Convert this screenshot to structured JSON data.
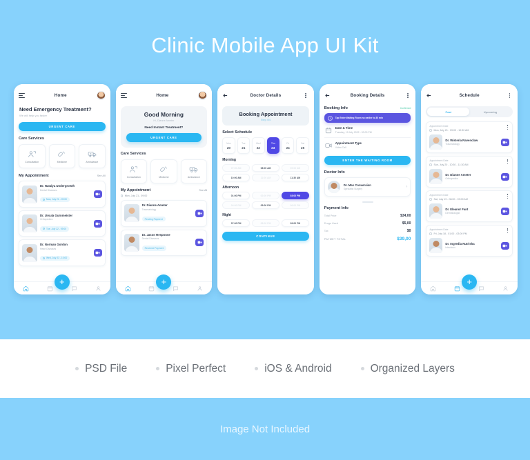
{
  "hero": {
    "title": "Clinic Mobile App UI Kit",
    "bg_color": "#87d2fc"
  },
  "theme": {
    "accent": "#2ab7f2",
    "purple": "#5048e5",
    "text": "#2b3445",
    "muted": "#a8b2bd",
    "green": "#49c9a7"
  },
  "screens": [
    {
      "id": "home-emergency",
      "header": {
        "title": "Home",
        "left_icon": "hamburger-menu-icon",
        "right_icon": "avatar"
      },
      "emergency": {
        "title": "Need Emergency Treatment?",
        "subtitle": "We will help you faster",
        "button": "URGENT CARE"
      },
      "care_services": {
        "title": "Care Services",
        "items": [
          {
            "label": "Consultation",
            "icon": "consultation-icon"
          },
          {
            "label": "Medicine",
            "icon": "medicine-icon"
          },
          {
            "label": "Ambulance",
            "icon": "ambulance-icon"
          }
        ]
      },
      "appointments": {
        "title": "My Appointment",
        "see_all": "See All",
        "items": [
          {
            "name": "Dr. Natalya Undergrowth",
            "specialty": "Dental Diseases",
            "chip": "Mon, July 21 - 09:00"
          },
          {
            "name": "Dr. Ursula Gurnmeister",
            "specialty": "Orthopedics",
            "chip": "Tue, July 22 - 09:00"
          },
          {
            "name": "Dr. Norman Gordon",
            "specialty": "Heart Diseases",
            "chip": "Wed, July 23 - 10:00"
          }
        ]
      },
      "nav": [
        "home-icon",
        "calendar-icon",
        "chat-icon",
        "profile-icon"
      ],
      "fab": "+"
    },
    {
      "id": "home-greeting",
      "header": {
        "title": "Home",
        "left_icon": "hamburger-menu-icon",
        "right_icon": "avatar"
      },
      "greeting": {
        "title": "Good Morning",
        "subtitle": "Hi, Dianne Ameter",
        "question": "Need Instant Treatment?",
        "button": "URGENT CARE"
      },
      "care_services": {
        "title": "Care Services",
        "items": [
          {
            "label": "Consultation",
            "icon": "consultation-icon"
          },
          {
            "label": "Medicine",
            "icon": "medicine-icon"
          },
          {
            "label": "Ambulance",
            "icon": "ambulance-icon"
          }
        ]
      },
      "appointments": {
        "title": "My Appointment",
        "see_all": "See All",
        "date_line": "Mon, July 21 - 09:00",
        "items": [
          {
            "name": "Dr. Dianne Ameter",
            "specialty": "Traumatology",
            "chip": "Pending Payment"
          },
          {
            "name": "Dr. Jason Response",
            "specialty": "Dental Diseases",
            "chip": "Received Payment"
          }
        ]
      },
      "nav": [
        "home-icon",
        "calendar-icon",
        "chat-icon",
        "profile-icon"
      ],
      "fab": "+"
    },
    {
      "id": "doctor-details",
      "header": {
        "title": "Doctor Details",
        "left_icon": "back-arrow-icon",
        "right_icon": "kebab-menu-icon"
      },
      "banner": {
        "title": "Booking Appointment",
        "subtitle": "Step 4/4"
      },
      "schedule": {
        "title": "Select Schedule",
        "days": [
          {
            "weekday": "Mon",
            "date": "20",
            "selected": false
          },
          {
            "weekday": "Tue",
            "date": "21",
            "selected": false
          },
          {
            "weekday": "Wed",
            "date": "22",
            "selected": false
          },
          {
            "weekday": "Thu",
            "date": "23",
            "selected": true
          },
          {
            "weekday": "Fri",
            "date": "24",
            "selected": false
          },
          {
            "weekday": "Sat",
            "date": "25",
            "selected": false
          }
        ]
      },
      "slot_groups": [
        {
          "label": "Morning",
          "rows": [
            [
              {
                "time": "07:00 AM",
                "state": "off"
              },
              {
                "time": "08:00 AM",
                "state": "available"
              },
              {
                "time": "09:00 AM",
                "state": "off"
              }
            ],
            [
              {
                "time": "10:00 AM",
                "state": "available"
              },
              {
                "time": "11:00 AM",
                "state": "off"
              },
              {
                "time": "11:30 AM",
                "state": "available"
              }
            ]
          ]
        },
        {
          "label": "Afternoon",
          "rows": [
            [
              {
                "time": "01:00 PM",
                "state": "available"
              },
              {
                "time": "02:00 PM",
                "state": "off"
              },
              {
                "time": "03:00 PM",
                "state": "selected"
              }
            ],
            [
              {
                "time": "04:00 PM",
                "state": "off"
              },
              {
                "time": "05:00 PM",
                "state": "available"
              },
              {
                "time": "06:00 PM",
                "state": "off"
              }
            ]
          ]
        },
        {
          "label": "Night",
          "rows": [
            [
              {
                "time": "07:00 PM",
                "state": "available"
              },
              {
                "time": "08:00 PM",
                "state": "off"
              },
              {
                "time": "09:00 PM",
                "state": "available"
              }
            ]
          ]
        }
      ],
      "continue_button": "CONTINUE"
    },
    {
      "id": "booking-details",
      "header": {
        "title": "Booking Details",
        "left_icon": "back-arrow-icon",
        "right_icon": "kebab-menu-icon"
      },
      "booking_info": {
        "title": "Booking Info",
        "status": "Confirmed"
      },
      "notice": "Tap Enter Waiting Room no earlier to 30 min",
      "details": [
        {
          "icon": "calendar-icon",
          "label": "Date & Time",
          "value": "Tuesday, 19 July 2022 - 03:00 PM"
        },
        {
          "icon": "video-camera-icon",
          "label": "Appointment Type",
          "value": "Video Call"
        }
      ],
      "enter_button": "ENTER THE WAITING ROOM",
      "doctor_info": {
        "title": "Doctor Info",
        "name": "Dr. Max Conversion",
        "specialty": "Specialist Surgery"
      },
      "payment": {
        "title": "Payment Info",
        "rows": [
          {
            "key": "Total Price",
            "value": "$34,00"
          },
          {
            "key": "Drugs Used",
            "value": "$5,00"
          },
          {
            "key": "Tax",
            "value": "$0"
          }
        ],
        "total": {
          "key": "PAYMET TOTAL",
          "value": "$39,00"
        }
      }
    },
    {
      "id": "schedule",
      "header": {
        "title": "Schedule",
        "left_icon": "back-arrow-icon",
        "right_icon": "kebab-menu-icon"
      },
      "tabs": [
        {
          "label": "Past",
          "active": true
        },
        {
          "label": "Upcoming",
          "active": false
        }
      ],
      "cards": [
        {
          "label": "Appointment Date",
          "date": "Mon, July 21 - 09:00 - 10:30 AM",
          "name": "Dr. Wisteria Ravenclaw",
          "specialty": "Traumatology"
        },
        {
          "label": "Appointment Date",
          "date": "Sun, July 20 - 10:30 - 11:30 AM",
          "name": "Dr. Dianne Ameter",
          "specialty": "Orthopedics"
        },
        {
          "label": "Appointment Date",
          "date": "Sat, July 19 - 08:00 - 09:00 AM",
          "name": "Dr. Eleanor Fant",
          "specialty": "Dermatologist"
        },
        {
          "label": "Appointment Date",
          "date": "Fri, July 18 - 01:00 - 03:00 PM",
          "name": "Dr. Ingredia Nutrisha",
          "specialty": "Infectious"
        }
      ],
      "nav": [
        "home-icon",
        "calendar-icon",
        "chat-icon",
        "profile-icon"
      ],
      "fab": "+"
    }
  ],
  "features": [
    {
      "label": "PSD File"
    },
    {
      "label": "Pixel Perfect"
    },
    {
      "label": "iOS & Android"
    },
    {
      "label": "Organized Layers"
    }
  ],
  "footer": {
    "note": "Image Not Included"
  }
}
